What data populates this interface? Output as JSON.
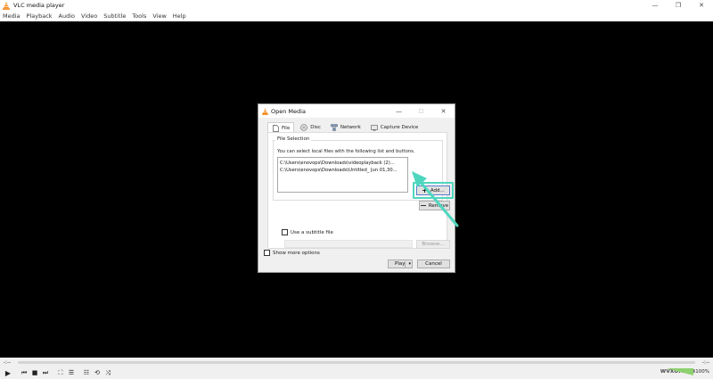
{
  "app": {
    "title": "VLC media player",
    "window_controls": [
      "—",
      "❐",
      "✕"
    ]
  },
  "menu": [
    "Media",
    "Playback",
    "Audio",
    "Video",
    "Subtitle",
    "Tools",
    "View",
    "Help"
  ],
  "seek": {
    "left_time": "-:--",
    "right_time": "-:--"
  },
  "controls": {
    "play": "▶",
    "prev": "⏮",
    "stop": "■",
    "next": "⏭",
    "fullscreen": "⛶",
    "extended": "☰",
    "playlist": "☷",
    "loop": "⟲",
    "random": "⤨",
    "volume_percent": "100%",
    "watermark": "wvxo.com"
  },
  "dialog": {
    "title": "Open Media",
    "tabs": [
      {
        "label": "File",
        "icon": "file-icon"
      },
      {
        "label": "Disc",
        "icon": "disc-icon"
      },
      {
        "label": "Network",
        "icon": "network-icon"
      },
      {
        "label": "Capture Device",
        "icon": "capture-device-icon"
      }
    ],
    "file_selection": {
      "group_label": "File Selection",
      "description": "You can select local files with the following list and buttons.",
      "files": [
        "C:\\Users\\enovops\\Downloads\\videoplayback (2)...",
        "C:\\Users\\enovops\\Downloads\\Untitled_ Jun 01,30..."
      ],
      "add_label": "Add...",
      "remove_label": "Remove"
    },
    "subtitle": {
      "checkbox_label": "Use a subtitle file",
      "browse_label": "Browse..."
    },
    "more_options_label": "Show more options",
    "play_label": "Play",
    "play_arrow": "▾",
    "cancel_label": "Cancel"
  },
  "colors": {
    "highlight": "#4fd6be",
    "volume": "#8ed16f",
    "vlc_orange": "#f58a1f"
  }
}
